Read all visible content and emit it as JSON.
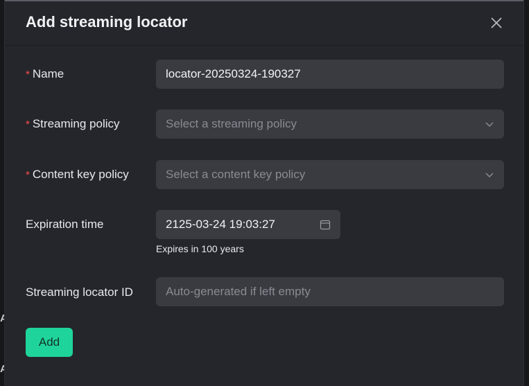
{
  "backdrop": {
    "fragments": [
      "A",
      "A"
    ]
  },
  "dialog": {
    "title": "Add streaming locator",
    "close_icon": "close-icon"
  },
  "form": {
    "required_mark": "*",
    "name": {
      "label": "Name",
      "value": "locator-20250324-190327",
      "required": true
    },
    "streaming_policy": {
      "label": "Streaming policy",
      "placeholder": "Select a streaming policy",
      "required": true,
      "icon": "chevron-down-icon"
    },
    "content_key_policy": {
      "label": "Content key policy",
      "placeholder": "Select a content key policy",
      "required": true,
      "icon": "chevron-down-icon"
    },
    "expiration_time": {
      "label": "Expiration time",
      "value": "2125-03-24 19:03:27",
      "hint": "Expires in 100 years",
      "icon": "calendar-icon"
    },
    "streaming_locator_id": {
      "label": "Streaming locator ID",
      "placeholder": "Auto-generated if left empty"
    }
  },
  "actions": {
    "add_label": "Add"
  },
  "colors": {
    "accent": "#1fd49a",
    "required": "#ff4d4f",
    "modal_bg": "#25262b",
    "field_bg": "#3a3b41"
  }
}
